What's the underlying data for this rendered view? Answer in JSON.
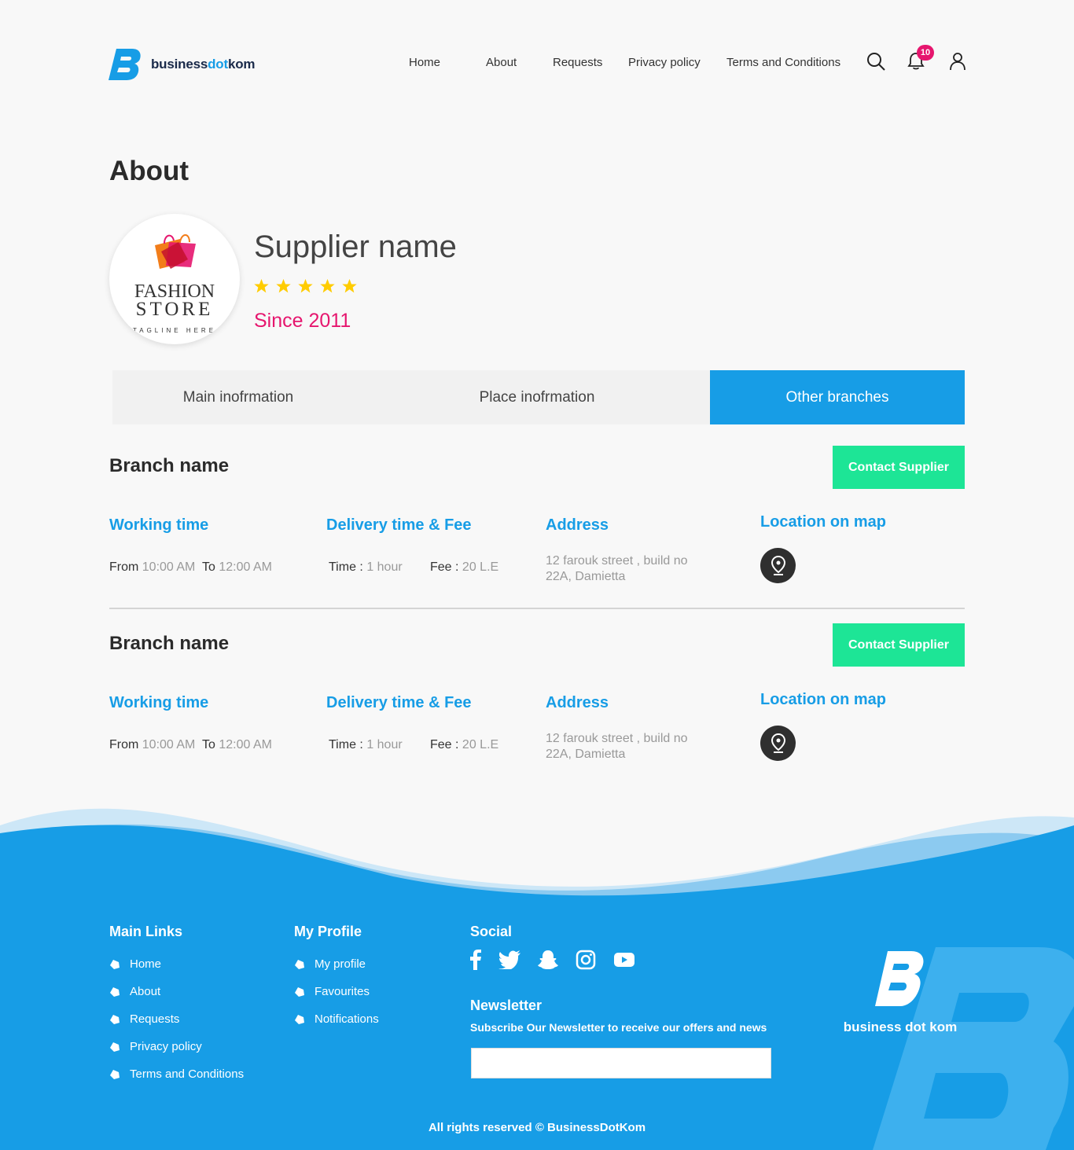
{
  "brand": {
    "logo_word1": "business",
    "logo_word2": "dot",
    "logo_word3": "kom"
  },
  "nav": {
    "items": [
      "Home",
      "About",
      "Requests",
      "Privacy policy",
      "Terms and Conditions"
    ],
    "notification_count": "10",
    "icons": [
      "search-icon",
      "bell-icon",
      "user-icon"
    ]
  },
  "about": {
    "title": "About",
    "supplier_name": "Supplier name",
    "rating": 5,
    "since": "Since 2011",
    "logo_line1": "FASHION",
    "logo_line2": "STORE",
    "logo_line3": "TAGLINE HERE"
  },
  "tabs": [
    {
      "label": "Main inofrmation",
      "active": false
    },
    {
      "label": "Place inofrmation",
      "active": false
    },
    {
      "label": "Other branches",
      "active": true
    }
  ],
  "branches": [
    {
      "name": "Branch name",
      "contact_label": "Contact Supplier",
      "working_title": "Working time",
      "from_label": "From",
      "from_value": "10:00 AM",
      "to_label": "To",
      "to_value": "12:00 AM",
      "delivery_title": "Delivery time & Fee",
      "time_label": "Time :",
      "time_value": "1 hour",
      "fee_label": "Fee :",
      "fee_value": "20 L.E",
      "address_title": "Address",
      "address": "12 farouk street , build no 22A, Damietta",
      "location_title": "Location on map"
    },
    {
      "name": "Branch name",
      "contact_label": "Contact Supplier",
      "working_title": "Working time",
      "from_label": "From",
      "from_value": "10:00 AM",
      "to_label": "To",
      "to_value": "12:00 AM",
      "delivery_title": "Delivery time & Fee",
      "time_label": "Time :",
      "time_value": "1 hour",
      "fee_label": "Fee :",
      "fee_value": "20 L.E",
      "address_title": "Address",
      "address": "12 farouk street , build no 22A, Damietta",
      "location_title": "Location on map"
    }
  ],
  "footer": {
    "main_links_title": "Main Links",
    "main_links": [
      "Home",
      "About",
      "Requests",
      "Privacy policy",
      "Terms and Conditions"
    ],
    "profile_title": "My Profile",
    "profile_links": [
      "My profile",
      "Favourites",
      "Notifications"
    ],
    "social_title": "Social",
    "social_icons": [
      "facebook-icon",
      "twitter-icon",
      "snapchat-icon",
      "instagram-icon",
      "youtube-icon"
    ],
    "newsletter_title": "Newsletter",
    "newsletter_subtitle": "Subscribe Our Newsletter to receive our offers and news",
    "newsletter_placeholder": "",
    "logo_text": "business dot kom",
    "copyright": "All rights reserved © BusinessDotKom"
  },
  "colors": {
    "accent": "#179de6",
    "pink": "#e6166e",
    "green": "#1de596",
    "star": "#ffcc00"
  }
}
